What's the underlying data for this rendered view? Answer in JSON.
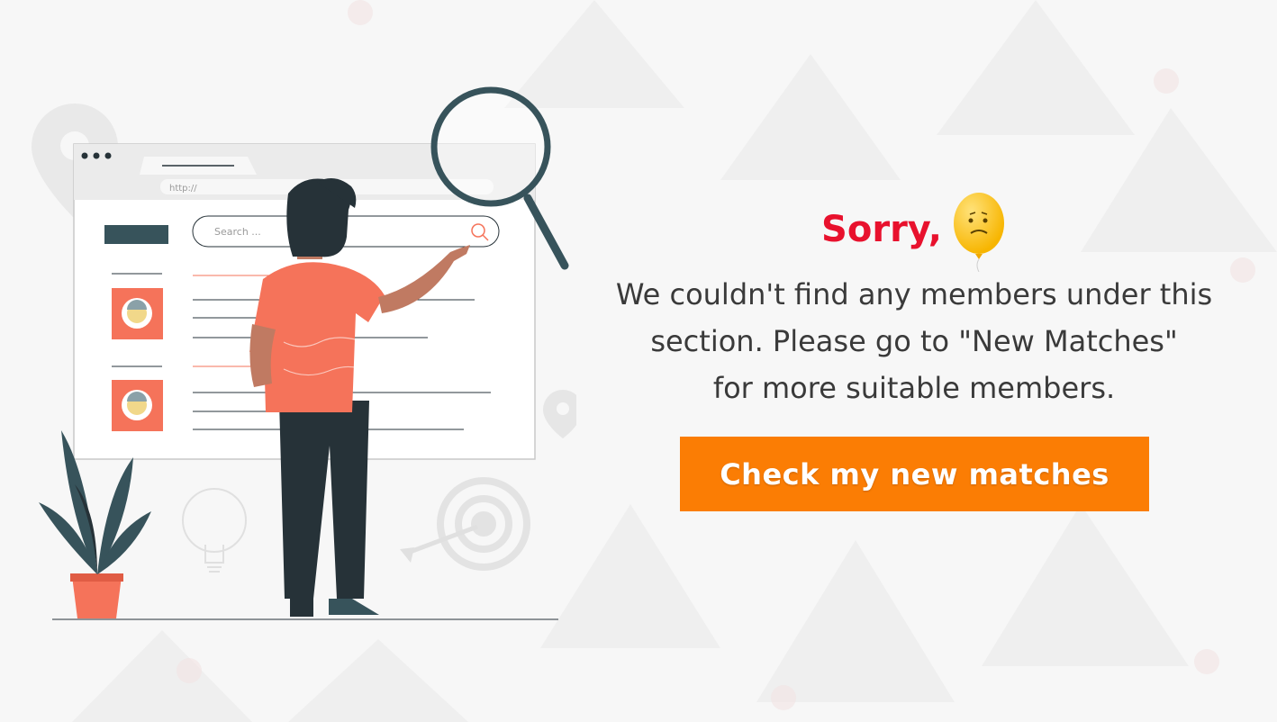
{
  "illustration": {
    "url_text": "http://",
    "search_placeholder": "Search ..."
  },
  "message": {
    "heading": "Sorry,",
    "lines": [
      "We couldn't find any members under this",
      "section. Please go to \"New Matches\"",
      "for more suitable members."
    ]
  },
  "cta": {
    "label": "Check my new matches"
  },
  "colors": {
    "accent_red": "#e8112d",
    "button_orange": "#fb7d04",
    "illustration_coral": "#f5735a",
    "illustration_dark": "#263238",
    "illustration_teal": "#37535b"
  }
}
